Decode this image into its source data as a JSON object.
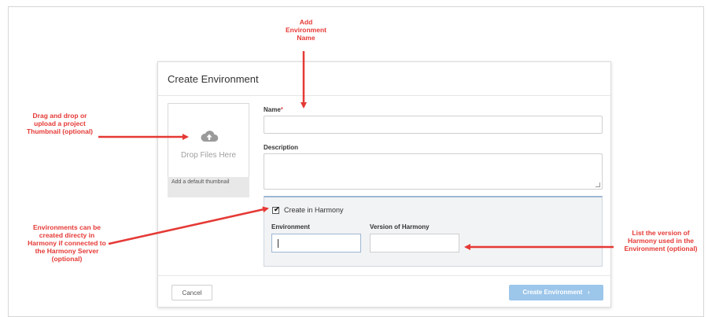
{
  "dialog": {
    "title": "Create Environment",
    "thumbnail": {
      "drop_text": "Drop Files Here",
      "footer_text": "Add a default thumbnail",
      "icon": "cloud-upload-icon"
    },
    "name_label": "Name",
    "required_marker": "*",
    "name_value": "",
    "description_label": "Description",
    "description_value": "",
    "harmony": {
      "checkbox_label": "Create in Harmony",
      "checked": true,
      "environment_label": "Environment",
      "environment_value": "",
      "version_label": "Version of Harmony",
      "version_value": ""
    },
    "cancel_label": "Cancel",
    "create_label": "Create Environment",
    "create_icon": "chevron-right-icon",
    "create_button_color": "#9cc6ea"
  },
  "annotations": {
    "add_name": "Add Environment Name",
    "thumbnail": "Drag and drop or upload a project Thumbnail (optional)",
    "harmony": "Environments can be created directy in Harmony if connected to the Harmony Server (optional)",
    "version": "List the version of Harmony used in the Environment (optional)",
    "color": "#e53935"
  }
}
